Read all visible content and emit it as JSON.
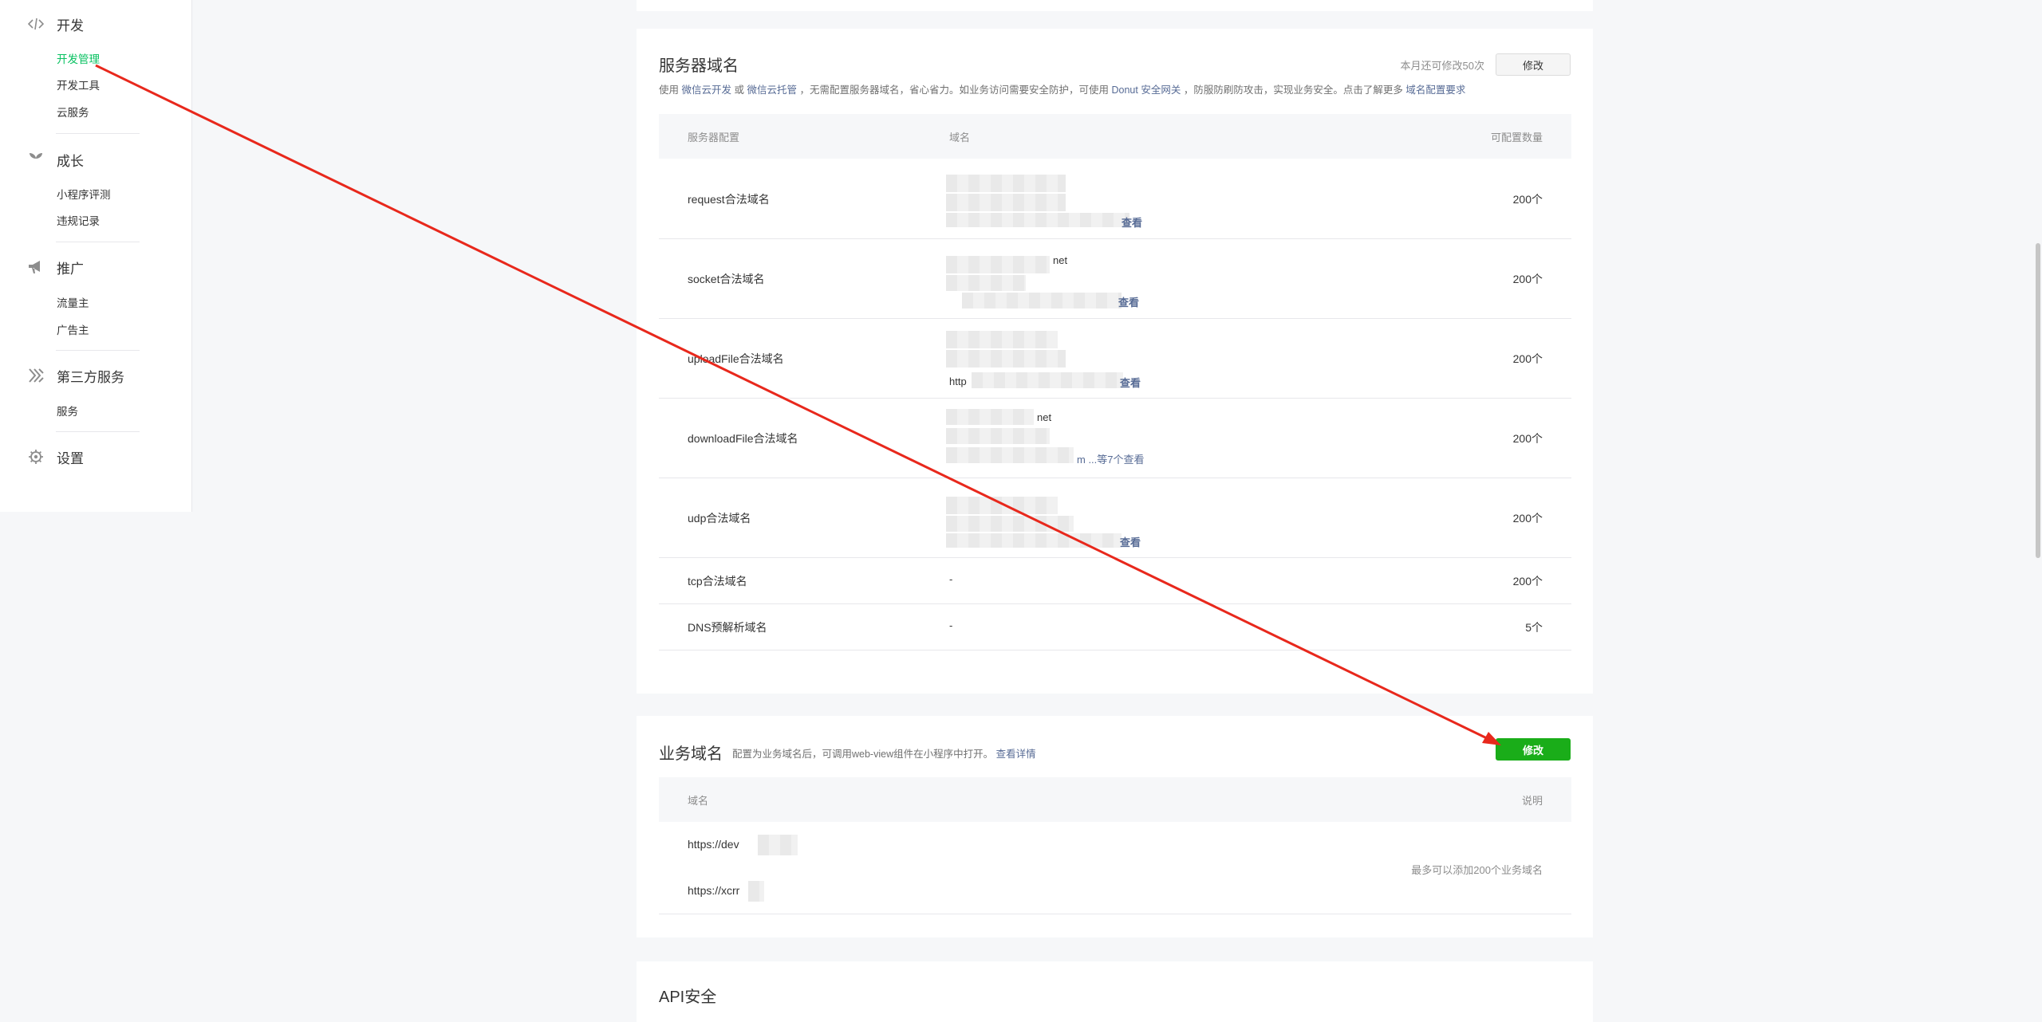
{
  "sidebar": {
    "groups": [
      {
        "icon": "code-icon",
        "label": "开发",
        "items": [
          "开发管理",
          "开发工具",
          "云服务"
        ]
      },
      {
        "icon": "sprout-icon",
        "label": "成长",
        "items": [
          "小程序评测",
          "违规记录"
        ]
      },
      {
        "icon": "megaphone-icon",
        "label": "推广",
        "items": [
          "流量主",
          "广告主"
        ]
      },
      {
        "icon": "third-party-icon",
        "label": "第三方服务",
        "items": [
          "服务"
        ]
      },
      {
        "icon": "gear-icon",
        "label": "设置",
        "items": []
      }
    ],
    "active_item": "开发管理"
  },
  "server_domain": {
    "title": "服务器域名",
    "quota_text": "本月还可修改50次",
    "edit_label": "修改",
    "desc_prefix": "使用",
    "desc_link1": "微信云开发",
    "desc_or": "或",
    "desc_link2": "微信云托管",
    "desc_mid": "，无需配置服务器域名，省心省力。如业务访问需要安全防护，可使用",
    "desc_link3": "Donut 安全网关",
    "desc_mid2": "，防服防刷防攻击，实现业务安全。点击了解更多",
    "desc_link4": "域名配置要求",
    "headers": [
      "服务器配置",
      "域名",
      "可配置数量"
    ],
    "rows": [
      {
        "name": "request合法域名",
        "domain_visible": "",
        "more": "查看",
        "count": "200个"
      },
      {
        "name": "socket合法域名",
        "domain_visible": "net",
        "more": "查看",
        "count": "200个"
      },
      {
        "name": "uploadFile合法域名",
        "domain_visible": "http",
        "more": "查看",
        "count": "200个"
      },
      {
        "name": "downloadFile合法域名",
        "domain_visible": "net",
        "more": "m ...等7个查看",
        "count": "200个"
      },
      {
        "name": "udp合法域名",
        "domain_visible": "",
        "more": "查看",
        "count": "200个"
      },
      {
        "name": "tcp合法域名",
        "domain_visible": "-",
        "more": "",
        "count": "200个"
      },
      {
        "name": "DNS预解析域名",
        "domain_visible": "-",
        "more": "",
        "count": "5个"
      }
    ]
  },
  "business_domain": {
    "title": "业务域名",
    "desc": "配置为业务域名后，可调用web-view组件在小程序中打开。",
    "desc_link": "查看详情",
    "edit_label": "修改",
    "headers": [
      "域名",
      "说明"
    ],
    "domains": [
      "https://dev",
      "https://xcrr"
    ],
    "note": "最多可以添加200个业务域名"
  },
  "api_security": {
    "title": "API安全"
  },
  "annotation": {
    "color": "#e8281c"
  }
}
